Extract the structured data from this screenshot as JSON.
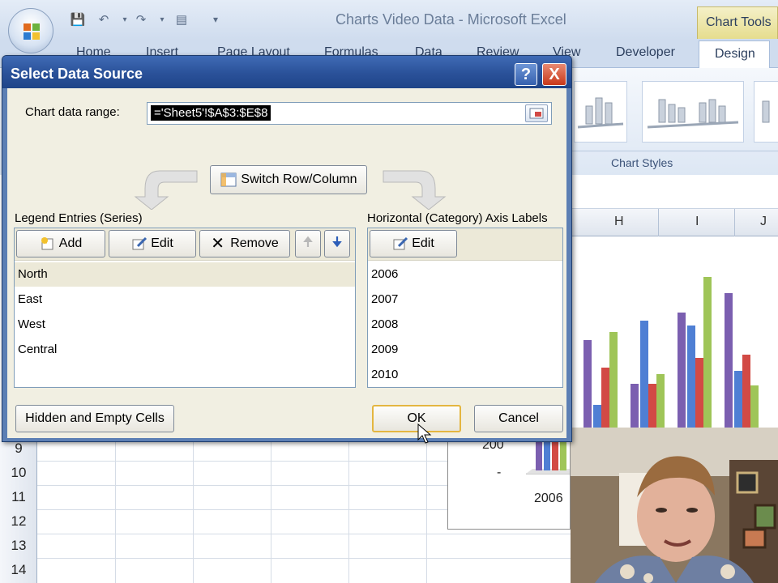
{
  "excel": {
    "title": "Charts Video Data - Microsoft Excel",
    "context_group": "Chart Tools",
    "tabs": [
      "Home",
      "Insert",
      "Page Layout",
      "Formulas",
      "Data",
      "Review",
      "View",
      "Developer",
      "Design"
    ],
    "active_tab": "Design",
    "ribbon_group": "Chart Styles",
    "columns": [
      "H",
      "I",
      "J"
    ],
    "rows": [
      "9",
      "10",
      "11",
      "12",
      "13",
      "14"
    ]
  },
  "chart": {
    "axis_tick_y": "200",
    "axis_tick_y_zero": "-",
    "axis_tick_x": "2006",
    "series_colors": [
      "#7b5fb0",
      "#4f7fd4",
      "#d24a45",
      "#9fc558"
    ]
  },
  "dialog": {
    "title": "Select Data Source",
    "help_label": "?",
    "close_label": "X",
    "range_label": "Chart data range:",
    "range_value": "='Sheet5'!$A$3:$E$8",
    "switch_label": "Switch Row/Column",
    "legend_label": "Legend Entries (Series)",
    "axis_label": "Horizontal (Category) Axis Labels",
    "legend_buttons": {
      "add": "Add",
      "edit": "Edit",
      "remove": "Remove"
    },
    "axis_edit": "Edit",
    "series": [
      "North",
      "East",
      "West",
      "Central"
    ],
    "selected_series": "North",
    "categories": [
      "2006",
      "2007",
      "2008",
      "2009",
      "2010"
    ],
    "hidden_cells": "Hidden and Empty Cells",
    "ok": "OK",
    "cancel": "Cancel"
  }
}
